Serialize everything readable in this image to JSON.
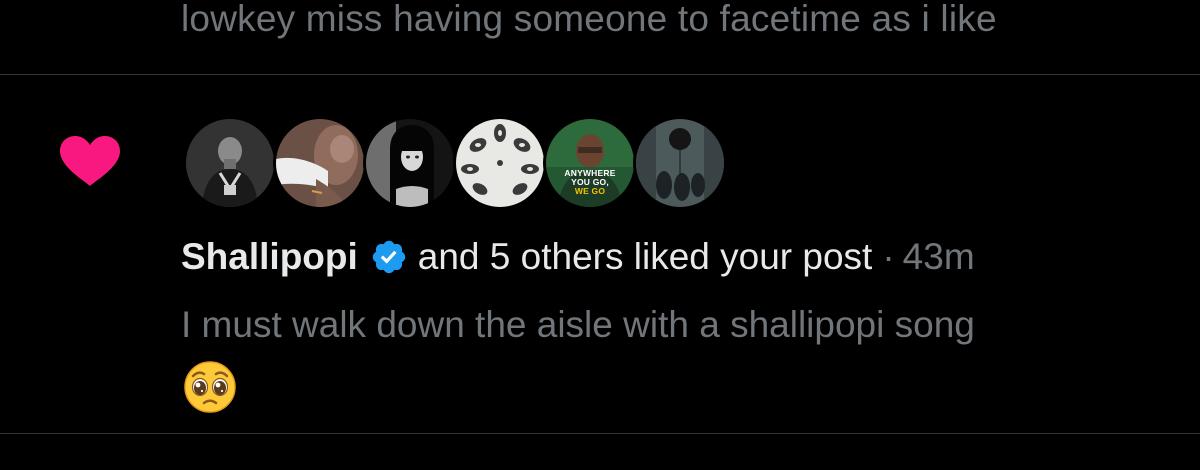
{
  "previous_post": {
    "text": "lowkey miss having someone to facetime as i like"
  },
  "notification": {
    "type_icon": "heart-icon",
    "heart_color": "#f91880",
    "avatars": [
      {
        "name": "avatar-user-1"
      },
      {
        "name": "avatar-user-2"
      },
      {
        "name": "avatar-user-3"
      },
      {
        "name": "avatar-user-4"
      },
      {
        "name": "avatar-user-5",
        "caption_line1": "ANYWHERE",
        "caption_line2": "YOU GO,",
        "caption_line3": "WE GO"
      },
      {
        "name": "avatar-user-6"
      }
    ],
    "user_name": "Shallipopi",
    "verified_icon": "verified-badge-icon",
    "verified_color": "#1d9bf0",
    "action_text": "and 5 others liked your post",
    "separator": "·",
    "time": "43m",
    "post_text": "I must walk down the aisle with a shallipopi song",
    "post_emoji": "pleading-face-emoji"
  }
}
